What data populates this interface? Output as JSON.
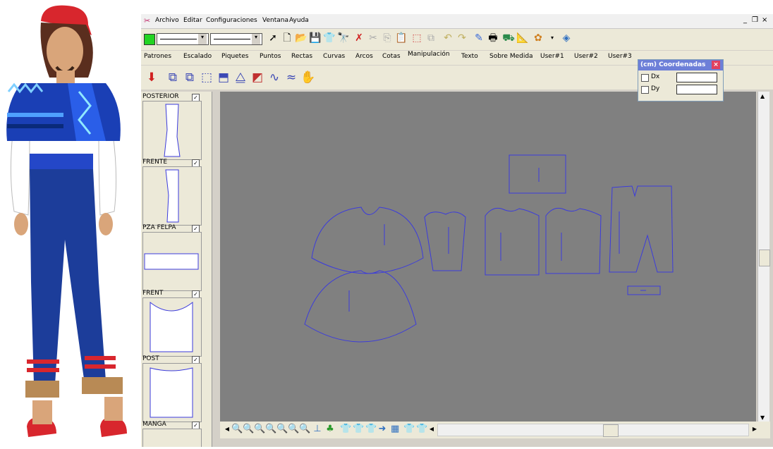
{
  "menu": [
    "Archivo",
    "Editar",
    "Configuraciones",
    "Ventana",
    "Ayuda"
  ],
  "window_controls": [
    "_",
    "❒",
    "×"
  ],
  "tabs": [
    "Patrones",
    "Escalado",
    "Piquetes",
    "Puntos",
    "Rectas",
    "Curvas",
    "Arcos",
    "Cotas",
    "Manipulación",
    "Texto",
    "Sobre Medida",
    "User#1",
    "User#2",
    "User#3"
  ],
  "active_tab": "Manipulación",
  "pieces": [
    {
      "label": "POSTERIOR",
      "checked": true
    },
    {
      "label": "FRENTE",
      "checked": true
    },
    {
      "label": "PZA FELPA",
      "checked": true
    },
    {
      "label": "FRENT",
      "checked": true
    },
    {
      "label": "POST",
      "checked": true
    },
    {
      "label": "MANGA",
      "checked": true
    }
  ],
  "coords_panel": {
    "title": "(cm) Coordenadas",
    "dx_label": "Dx",
    "dy_label": "Dy",
    "dx_value": "",
    "dy_value": ""
  },
  "colors": {
    "canvas": "#808080",
    "pattern_line": "#3b3bdc",
    "tab_bar": "#ece9d8",
    "title_bar": "#6d7fd8"
  }
}
